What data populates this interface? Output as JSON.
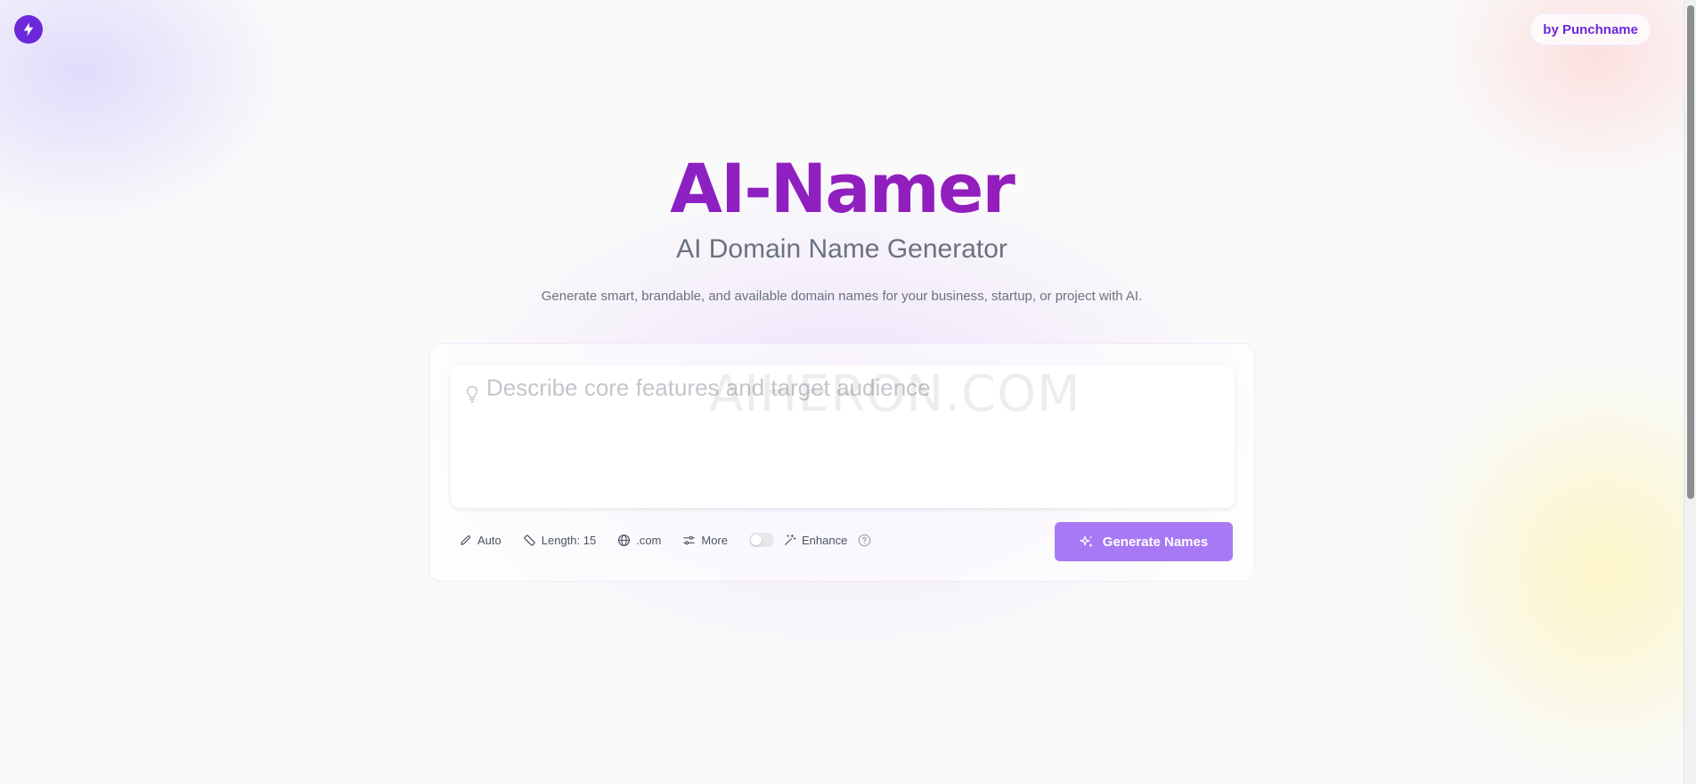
{
  "header": {
    "logo_icon": "lightning-bolt-icon",
    "by_link": "by Punchname"
  },
  "hero": {
    "brand": "AI-Namer",
    "subtitle": "AI Domain Name Generator",
    "tagline": "Generate smart, brandable, and available domain names for your business, startup, or project with AI."
  },
  "form": {
    "prompt_placeholder": "Describe core features and target audience",
    "prompt_value": "",
    "watermark": "AIHERON.COM",
    "controls": {
      "style": "Auto",
      "length": "Length: 15",
      "tld": ".com",
      "more": "More",
      "enhance": "Enhance",
      "enhance_enabled": false
    },
    "generate_label": "Generate Names"
  },
  "colors": {
    "accent": "#6d28d9",
    "button": "#a879f4",
    "brand_gradient_start": "#7e22ce",
    "brand_gradient_end": "#a21caf"
  }
}
